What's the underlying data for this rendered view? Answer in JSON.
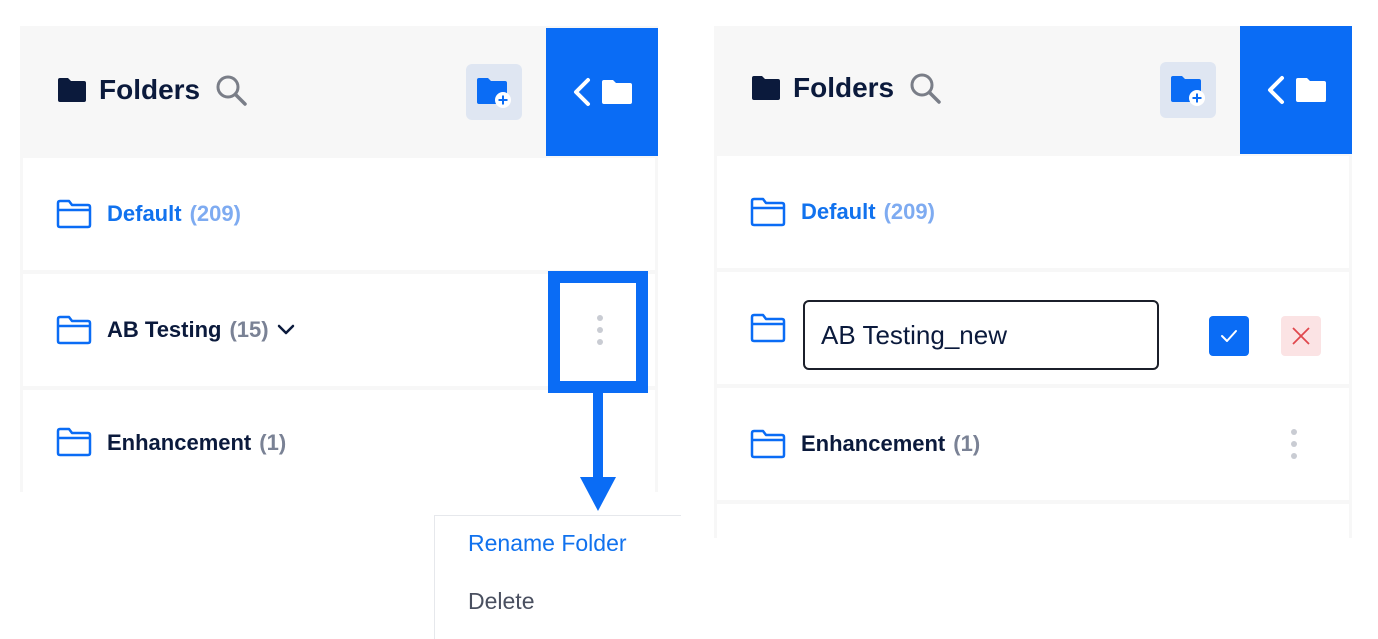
{
  "left_panel": {
    "title": "Folders",
    "folders": [
      {
        "name": "Default",
        "count": "(209)"
      },
      {
        "name": "AB Testing",
        "count": "(15)"
      },
      {
        "name": "Enhancement",
        "count": "(1)"
      }
    ],
    "context_menu": {
      "rename_label": "Rename Folder",
      "delete_label": "Delete"
    }
  },
  "right_panel": {
    "title": "Folders",
    "folders": [
      {
        "name": "Default",
        "count": "(209)"
      },
      {
        "name": "Enhancement",
        "count": "(1)"
      }
    ],
    "rename_input_value": "AB Testing_new"
  },
  "icons": {
    "folder": "folder-icon",
    "search": "search-icon",
    "new_folder": "folder-plus-icon",
    "collapse": "chevron-left-icon",
    "more": "kebab-icon",
    "confirm": "check-icon",
    "cancel": "close-icon",
    "expand": "chevron-down-icon"
  },
  "colors": {
    "accent": "#0a6cf5",
    "link": "#1172ee",
    "text": "#0b1a3c",
    "muted": "#7a8295",
    "panel_bg": "#f7f7f7",
    "cancel_bg": "#fbe3e4",
    "cancel_x": "#e0474c"
  }
}
